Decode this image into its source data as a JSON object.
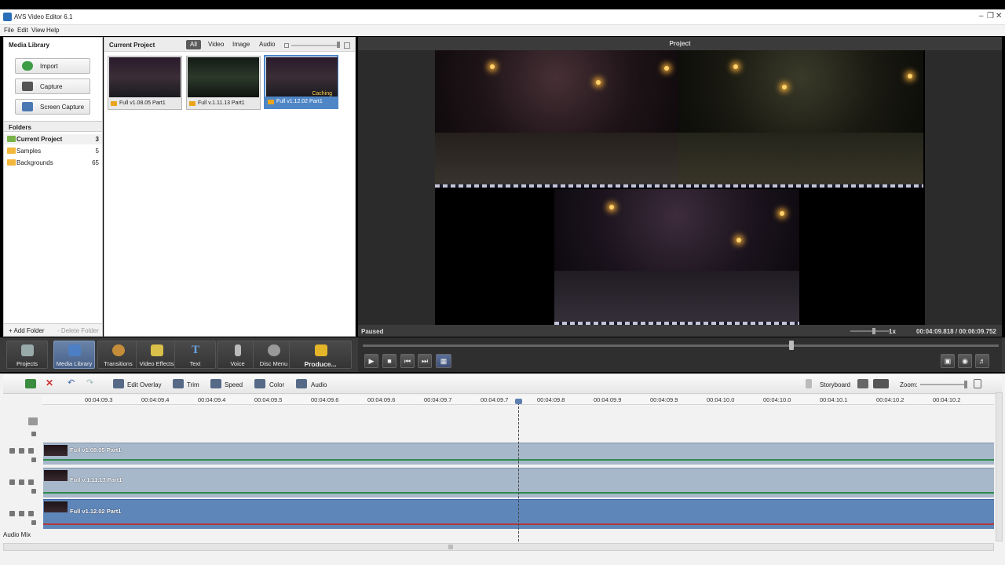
{
  "window": {
    "title": "AVS Video Editor 6.1"
  },
  "menu": [
    "File",
    "Edit",
    "View",
    "Help"
  ],
  "media_library": {
    "title": "Media Library",
    "buttons": [
      {
        "label": "Import",
        "icon": "plus-circle-icon"
      },
      {
        "label": "Capture",
        "icon": "capture-icon"
      },
      {
        "label": "Screen Capture",
        "icon": "screen-capture-icon"
      }
    ],
    "folders_title": "Folders",
    "folders": [
      {
        "name": "Current Project",
        "count": "3"
      },
      {
        "name": "Samples",
        "count": "5"
      },
      {
        "name": "Backgrounds",
        "count": "65"
      }
    ],
    "add_folder": "+ Add Folder",
    "delete_folder": "- Delete Folder"
  },
  "current_project": {
    "title": "Current Project",
    "filters": [
      "All",
      "Video",
      "Image",
      "Audio"
    ],
    "active_filter": "All",
    "clips": [
      {
        "name": "Full v1.08.05 Part1",
        "selected": false,
        "badge": ""
      },
      {
        "name": "Full v.1.11.13 Part1",
        "selected": false,
        "badge": ""
      },
      {
        "name": "Full v1.12.02 Part1",
        "selected": true,
        "badge": "Caching"
      }
    ]
  },
  "preview": {
    "title": "Project",
    "status": "Paused",
    "speed": "1x",
    "time": "00:04:09.818 / 00:06:09.752",
    "play_position": 0.675
  },
  "toolbar": [
    {
      "label": "Projects",
      "icon": "projects-icon",
      "active": false
    },
    {
      "label": "Media Library",
      "icon": "media-library-icon",
      "active": true
    },
    {
      "label": "Transitions",
      "icon": "transitions-icon",
      "active": false
    },
    {
      "label": "Video Effects",
      "icon": "video-effects-icon",
      "active": false
    },
    {
      "label": "Text",
      "icon": "text-icon",
      "active": false
    },
    {
      "label": "Voice",
      "icon": "microphone-icon",
      "active": false
    },
    {
      "label": "Disc Menu",
      "icon": "disc-menu-icon",
      "active": false
    },
    {
      "label": "Produce...",
      "icon": "produce-icon",
      "active": false
    }
  ],
  "timeline_tools": {
    "edit_overlay": "Edit Overlay",
    "trim": "Trim",
    "speed": "Speed",
    "color": "Color",
    "audio": "Audio",
    "storyboard": "Storyboard",
    "zoom": "Zoom:"
  },
  "ruler": [
    "00:04:09.3",
    "00:04:09.4",
    "00:04:09.4",
    "00:04:09.5",
    "00:04:09.6",
    "00:04:09.6",
    "00:04:09.7",
    "00:04:09.7",
    "00:04:09.8",
    "00:04:09.9",
    "00:04:09.9",
    "00:04:10.0",
    "00:04:10.0",
    "00:04:10.1",
    "00:04:10.2",
    "00:04:10.2"
  ],
  "tracks": [
    {
      "name": "Full v1.08.05 Part1"
    },
    {
      "name": "Full v.1.11.13 Part1"
    },
    {
      "name": "Full v1.12.02 Part1"
    }
  ],
  "audio_mix": "Audio Mix"
}
